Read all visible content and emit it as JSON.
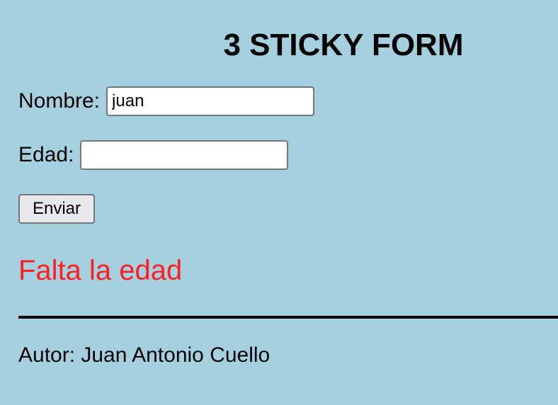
{
  "page": {
    "title": "3 STICKY FORM"
  },
  "form": {
    "nombre_label": "Nombre:",
    "nombre_value": "juan",
    "edad_label": "Edad:",
    "edad_value": "",
    "submit_label": "Enviar"
  },
  "message": {
    "error": "Falta la edad",
    "color": "#ff1e1e"
  },
  "footer": {
    "author": "Autor: Juan Antonio Cuello"
  },
  "colors": {
    "background": "#a4d0e0"
  }
}
